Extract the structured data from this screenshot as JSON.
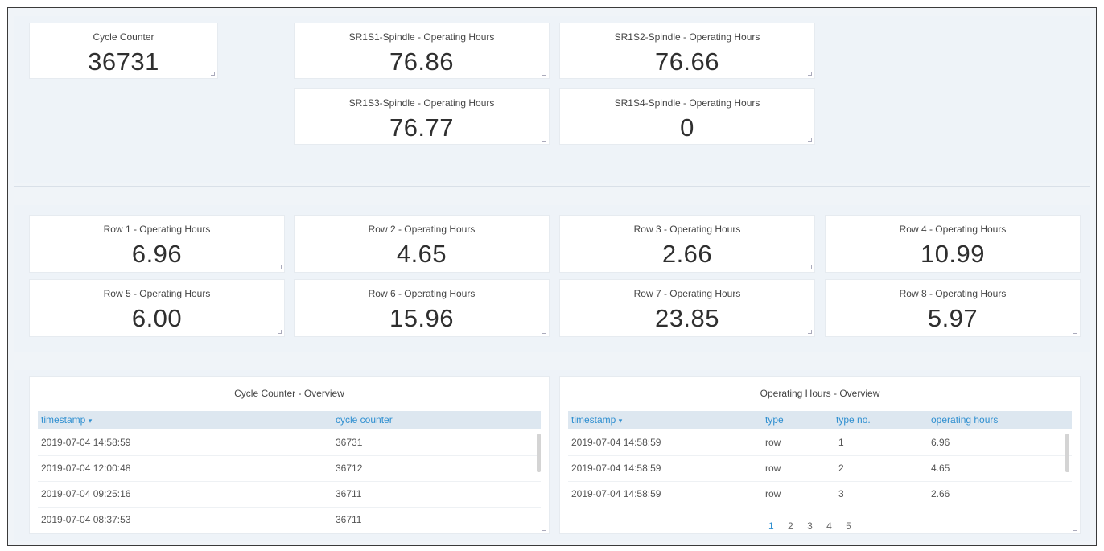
{
  "spindles": {
    "cycle_counter": {
      "title": "Cycle Counter",
      "value": "36731"
    },
    "s1": {
      "title": "SR1S1-Spindle - Operating Hours",
      "value": "76.86"
    },
    "s2": {
      "title": "SR1S2-Spindle - Operating Hours",
      "value": "76.66"
    },
    "s3": {
      "title": "SR1S3-Spindle - Operating Hours",
      "value": "76.77"
    },
    "s4": {
      "title": "SR1S4-Spindle - Operating Hours",
      "value": "0"
    }
  },
  "rows": [
    {
      "title": "Row 1 - Operating Hours",
      "value": "6.96"
    },
    {
      "title": "Row 2 - Operating Hours",
      "value": "4.65"
    },
    {
      "title": "Row 3 - Operating Hours",
      "value": "2.66"
    },
    {
      "title": "Row 4 - Operating Hours",
      "value": "10.99"
    },
    {
      "title": "Row 5 - Operating Hours",
      "value": "6.00"
    },
    {
      "title": "Row 6 - Operating Hours",
      "value": "15.96"
    },
    {
      "title": "Row 7 - Operating Hours",
      "value": "23.85"
    },
    {
      "title": "Row 8 - Operating Hours",
      "value": "5.97"
    }
  ],
  "cycle_overview": {
    "title": "Cycle Counter - Overview",
    "columns": [
      "timestamp",
      "cycle counter"
    ],
    "sort_caret": "▾",
    "rows": [
      [
        "2019-07-04 14:58:59",
        "36731"
      ],
      [
        "2019-07-04 12:00:48",
        "36712"
      ],
      [
        "2019-07-04 09:25:16",
        "36711"
      ],
      [
        "2019-07-04 08:37:53",
        "36711"
      ]
    ]
  },
  "hours_overview": {
    "title": "Operating Hours - Overview",
    "columns": [
      "timestamp",
      "type",
      "type no.",
      "operating hours"
    ],
    "sort_caret": "▾",
    "rows": [
      [
        "2019-07-04 14:58:59",
        "row",
        "1",
        "6.96"
      ],
      [
        "2019-07-04 14:58:59",
        "row",
        "2",
        "4.65"
      ],
      [
        "2019-07-04 14:58:59",
        "row",
        "3",
        "2.66"
      ]
    ],
    "pages": [
      "1",
      "2",
      "3",
      "4",
      "5"
    ]
  },
  "colors": {
    "accent": "#2f8fd0",
    "header_bg": "#dde7f0",
    "section_bg": "#eef3f8"
  }
}
